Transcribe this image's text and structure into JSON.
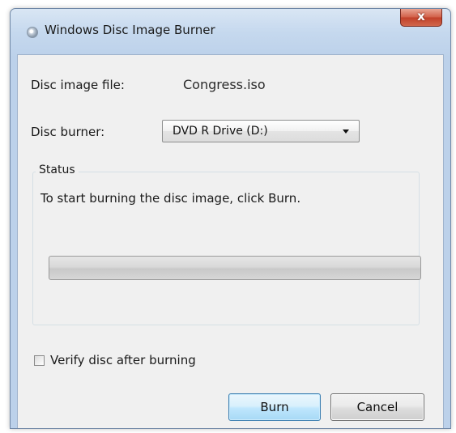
{
  "window": {
    "title": "Windows Disc Image Burner",
    "close_label": "x"
  },
  "disc_image": {
    "label": "Disc image file:",
    "value": "Congress.iso"
  },
  "disc_burner": {
    "label": "Disc burner:",
    "selected": "DVD R Drive (D:)"
  },
  "status": {
    "group_label": "Status",
    "message": "To start burning the disc image, click Burn.",
    "progress_percent": 0
  },
  "verify": {
    "label": "Verify disc after burning",
    "checked": false
  },
  "buttons": {
    "burn": "Burn",
    "cancel": "Cancel"
  },
  "icons": {
    "title": "disc-icon",
    "close": "close-icon",
    "dropdown": "chevron-down-icon"
  },
  "colors": {
    "close_button": "#c8452e",
    "default_button_border": "#3c7fb1"
  }
}
